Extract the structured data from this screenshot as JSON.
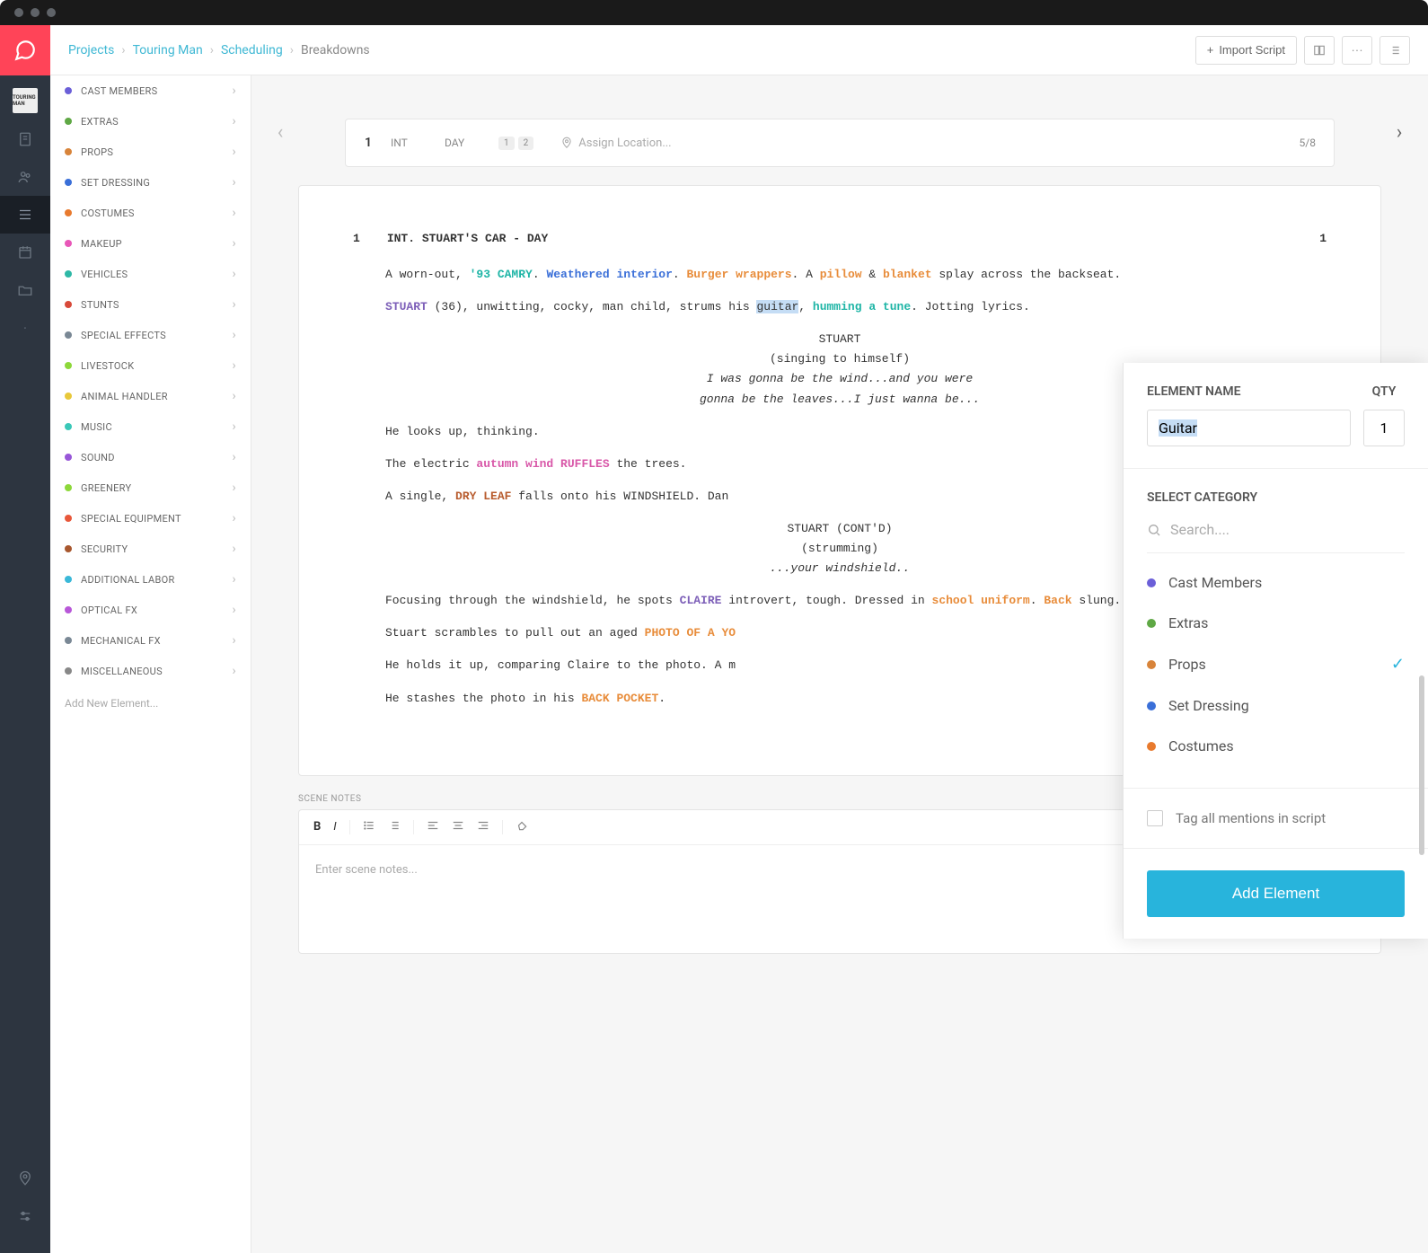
{
  "window": {
    "dots": [
      "#5f6368",
      "#5f6368",
      "#5f6368"
    ]
  },
  "rail": {
    "thumb": "TOURING MAN",
    "items": [
      "script",
      "cast",
      "breakdown",
      "calendar",
      "files",
      "",
      "location",
      "settings"
    ]
  },
  "breadcrumb": {
    "projects": "Projects",
    "project": "Touring Man",
    "section": "Scheduling",
    "page": "Breakdowns"
  },
  "top_actions": {
    "import": "Import Script"
  },
  "categories": [
    {
      "label": "CAST MEMBERS",
      "color": "#6b5fd8"
    },
    {
      "label": "EXTRAS",
      "color": "#5fa845"
    },
    {
      "label": "PROPS",
      "color": "#d8843a"
    },
    {
      "label": "SET DRESSING",
      "color": "#3a6fd8"
    },
    {
      "label": "COSTUMES",
      "color": "#e87a2e"
    },
    {
      "label": "MAKEUP",
      "color": "#e857b8"
    },
    {
      "label": "VEHICLES",
      "color": "#2eb8a6"
    },
    {
      "label": "STUNTS",
      "color": "#d84a3a"
    },
    {
      "label": "SPECIAL EFFECTS",
      "color": "#7a8895"
    },
    {
      "label": "LIVESTOCK",
      "color": "#8dd83a"
    },
    {
      "label": "ANIMAL HANDLER",
      "color": "#e8c83a"
    },
    {
      "label": "MUSIC",
      "color": "#3ac8b8"
    },
    {
      "label": "SOUND",
      "color": "#9857d8"
    },
    {
      "label": "GREENERY",
      "color": "#8dd83a"
    },
    {
      "label": "SPECIAL EQUIPMENT",
      "color": "#e8573a"
    },
    {
      "label": "SECURITY",
      "color": "#a8572e"
    },
    {
      "label": "ADDITIONAL LABOR",
      "color": "#3ab8d8"
    },
    {
      "label": "OPTICAL FX",
      "color": "#b857d8"
    },
    {
      "label": "MECHANICAL FX",
      "color": "#7a8895"
    },
    {
      "label": "MISCELLANEOUS",
      "color": "#888"
    }
  ],
  "add_element_placeholder": "Add New Element...",
  "scene": {
    "num": "1",
    "ie": "INT",
    "time": "DAY",
    "badges": [
      "1",
      "2"
    ],
    "loc_placeholder": "Assign Location...",
    "pages": "5/8",
    "slugline_left": "1",
    "slugline": "INT. STUART'S CAR - DAY",
    "slugline_right": "1"
  },
  "script": {
    "p1_a": "A worn-out, ",
    "p1_camry": "'93 CAMRY",
    "p1_b": ". ",
    "p1_weather": "Weathered interior",
    "p1_c": ". ",
    "p1_burger": "Burger wrappers",
    "p1_d": ". A ",
    "p1_pillow": "pillow",
    "p1_e": " & ",
    "p1_blanket": "blanket",
    "p1_f": " splay across the backseat.",
    "p2_stuart": "STUART",
    "p2_a": " (36), unwitting, cocky, man child, strums his ",
    "p2_guitar": "guitar",
    "p2_b": ", ",
    "p2_humming": "humming a tune",
    "p2_c": ". Jotting lyrics.",
    "d1_char": "STUART",
    "d1_paren": "(singing to himself)",
    "d1_line": "I was gonna be the wind...and you were gonna be the leaves...I just wanna be...",
    "p3": "He looks up, thinking.",
    "p4_a": "The electric ",
    "p4_wind": "autumn wind RUFFLES",
    "p4_b": " the trees.",
    "p5_a": "A single, ",
    "p5_leaf": "DRY LEAF",
    "p5_b": " falls onto his WINDSHIELD. Dan",
    "d2_char": "STUART (CONT'D)",
    "d2_paren": "(strumming)",
    "d2_line": "...your windshield..",
    "p6_a": "Focusing through the windshield, he spots ",
    "p6_claire": "CLAIRE",
    "p6_b": " introvert, tough. Dressed in ",
    "p6_uniform": "school uniform",
    "p6_c": ". ",
    "p6_back": "Back",
    "p6_d": " slung.",
    "p7_a": "Stuart scrambles to pull out an aged ",
    "p7_photo": "PHOTO OF A YO",
    "p8": "He holds it up, comparing Claire to the photo. A m",
    "p9_a": "He stashes the photo in his ",
    "p9_pocket": "BACK POCKET",
    "p9_b": "."
  },
  "notes": {
    "label": "SCENE NOTES",
    "placeholder": "Enter scene notes..."
  },
  "panel": {
    "name_label": "ELEMENT NAME",
    "qty_label": "QTY",
    "name_value": "Guitar",
    "qty_value": "1",
    "select_cat": "SELECT CATEGORY",
    "search_placeholder": "Search....",
    "cats": [
      {
        "label": "Cast Members",
        "color": "#6b5fd8",
        "checked": false
      },
      {
        "label": "Extras",
        "color": "#5fa845",
        "checked": false
      },
      {
        "label": "Props",
        "color": "#d8843a",
        "checked": true
      },
      {
        "label": "Set Dressing",
        "color": "#3a6fd8",
        "checked": false
      },
      {
        "label": "Costumes",
        "color": "#e87a2e",
        "checked": false
      }
    ],
    "tag_all": "Tag all mentions in script",
    "add_btn": "Add Element"
  }
}
